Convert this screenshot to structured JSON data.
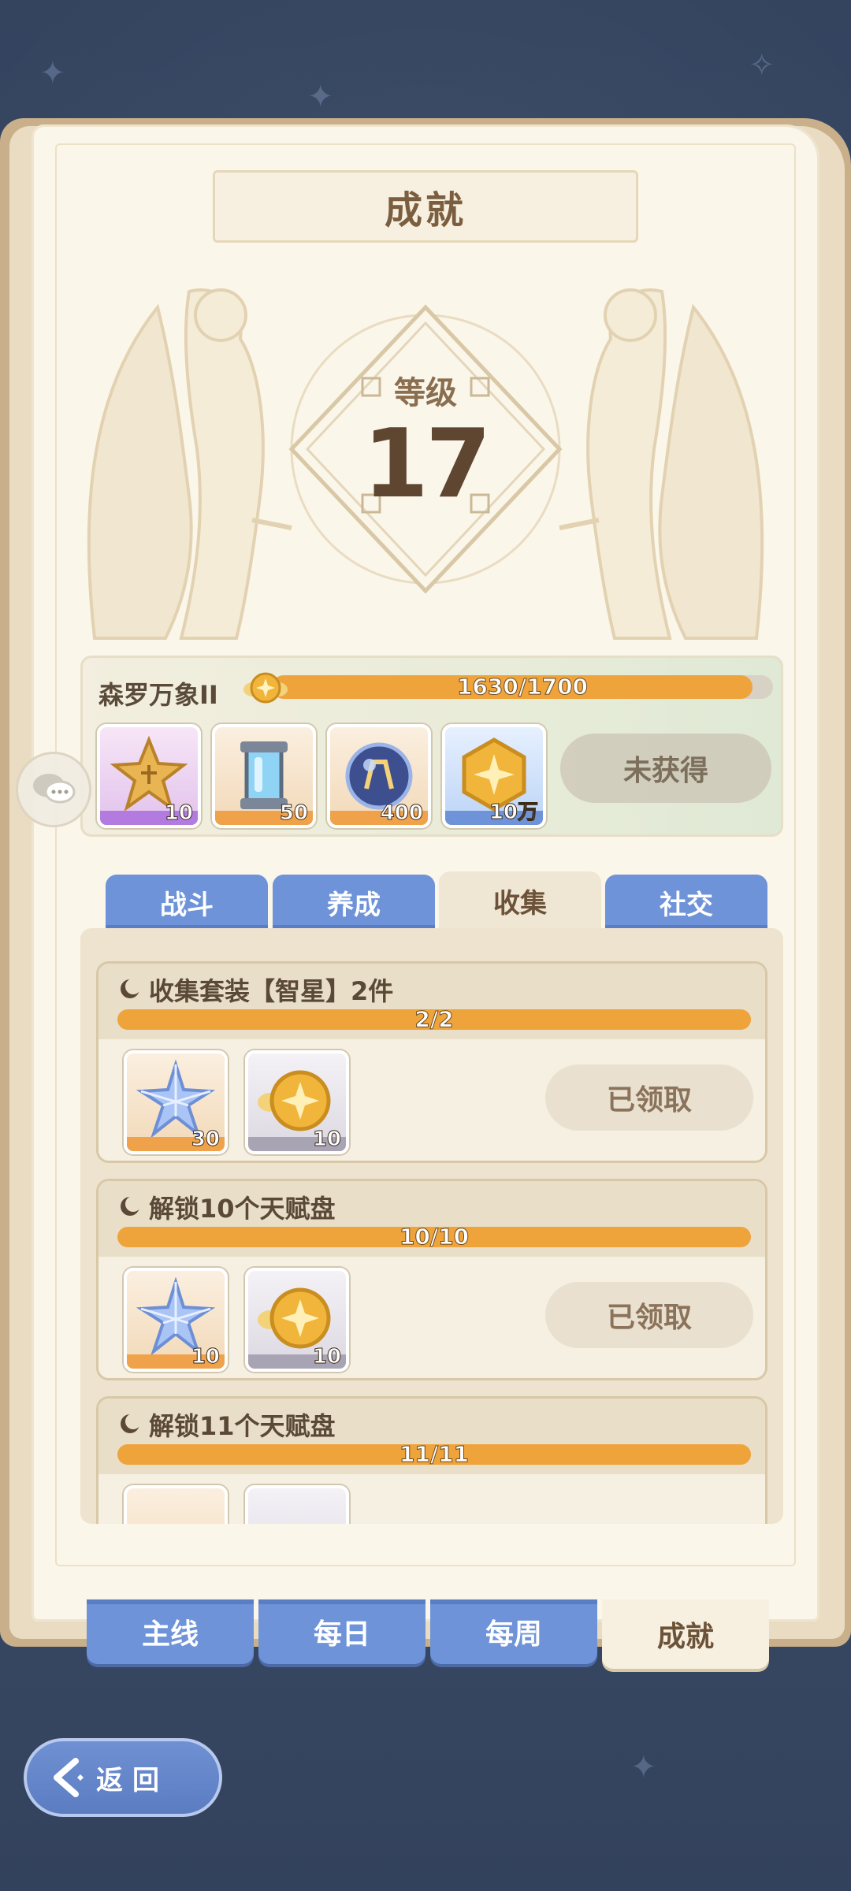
{
  "page": {
    "title": "成就"
  },
  "level": {
    "label": "等级",
    "value": "17"
  },
  "tier_reward": {
    "name": "森罗万象II",
    "progress_text": "1630/1700",
    "progress_fraction": 0.959,
    "items": [
      {
        "icon": "star-cookie-icon",
        "qty": "10"
      },
      {
        "icon": "energy-canister-icon",
        "qty": "50"
      },
      {
        "icon": "crystal-orb-icon",
        "qty": "400"
      },
      {
        "icon": "gold-hexagon-coin-icon",
        "qty": "10万"
      }
    ],
    "button_label": "未获得"
  },
  "category_tabs": [
    {
      "label": "战斗",
      "active": false
    },
    {
      "label": "养成",
      "active": false
    },
    {
      "label": "收集",
      "active": true
    },
    {
      "label": "社交",
      "active": false
    }
  ],
  "achievements": [
    {
      "title": "收集套装【智星】2件",
      "progress_text": "2/2",
      "rewards": [
        {
          "icon": "blue-star-crystal-icon",
          "qty": "30"
        },
        {
          "icon": "winged-gold-coin-icon",
          "qty": "10"
        }
      ],
      "button_label": "已领取"
    },
    {
      "title": "解锁10个天赋盘",
      "progress_text": "10/10",
      "rewards": [
        {
          "icon": "blue-star-crystal-icon",
          "qty": "10"
        },
        {
          "icon": "winged-gold-coin-icon",
          "qty": "10"
        }
      ],
      "button_label": "已领取"
    },
    {
      "title": "解锁11个天赋盘",
      "progress_text": "11/11",
      "rewards": [],
      "button_label": ""
    }
  ],
  "main_tabs": [
    {
      "label": "主线",
      "active": false
    },
    {
      "label": "每日",
      "active": false
    },
    {
      "label": "每周",
      "active": false
    },
    {
      "label": "成就",
      "active": true
    }
  ],
  "back_button": {
    "label": "返回"
  },
  "colors": {
    "accent_orange": "#efa33b",
    "tab_blue": "#6e93d8",
    "parchment": "#fbf6ea",
    "text_brown": "#5b4937"
  }
}
